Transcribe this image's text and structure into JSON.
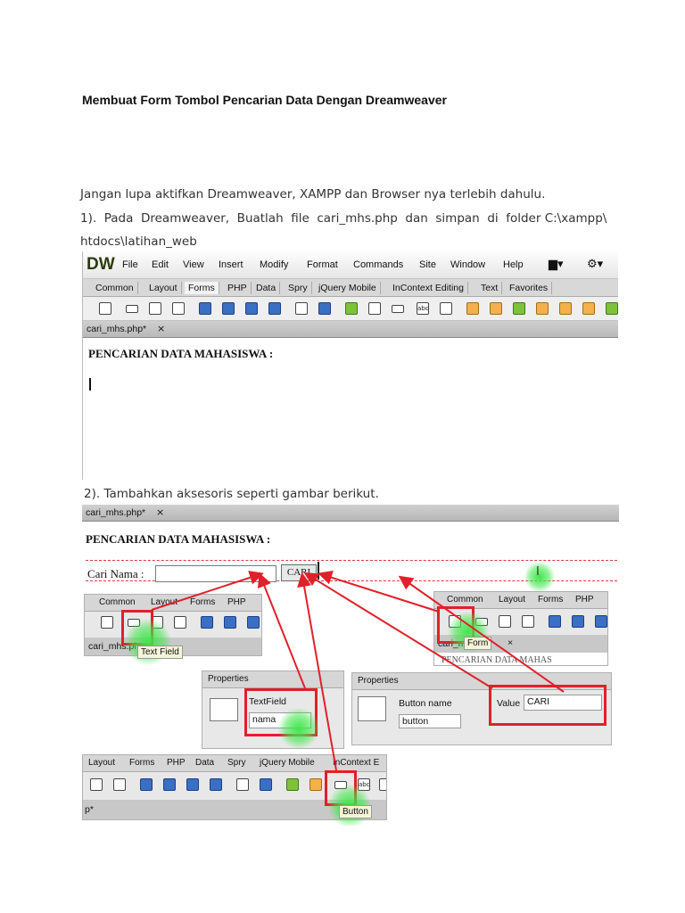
{
  "title": "Membuat Form  Tombol Pencarian Data Dengan Dreamweaver",
  "intro": "Jangan lupa aktifkan Dreamweaver, XAMPP dan Browser nya terlebih dahulu.",
  "step1": {
    "line1": "1).  Pada  Dreamweaver,  Buatlah  file  cari_mhs.php  dan  simpan  di  folder C:\\xampp\\",
    "line2": "htdocs\\latihan_web"
  },
  "step2": "2). Tambahkan aksesoris seperti gambar berikut.",
  "dw": {
    "logo": "DW",
    "menu": [
      "File",
      "Edit",
      "View",
      "Insert",
      "Modify",
      "Format",
      "Commands",
      "Site",
      "Window",
      "Help"
    ],
    "tabs": [
      "Common",
      "Layout",
      "Forms",
      "PHP",
      "Data",
      "Spry",
      "jQuery Mobile",
      "InContext Editing",
      "Text",
      "Favorites"
    ],
    "active_tab": "Forms",
    "doc_tab": "cari_mhs.php*",
    "close": "×",
    "page_heading": "PENCARIAN DATA MAHASISWA :"
  },
  "shot2": {
    "doc_tab": "cari_mhs.php*",
    "close": "×",
    "page_heading": "PENCARIAN DATA MAHASISWA :",
    "form_label": "Cari Nama :",
    "button_text": "CARI",
    "mini_tabs_left": [
      "Common",
      "Layout",
      "Forms",
      "PHP"
    ],
    "mini_doc_left": "cari_mhs.php",
    "tooltip_textfield": "Text Field",
    "mini_tabs_right": [
      "Common",
      "Layout",
      "Forms",
      "PHP"
    ],
    "mini_doc_right": "cari_m",
    "tooltip_form": "Form",
    "right_fragment": "PENCARIAN DATA MAHAS",
    "props1": {
      "tab": "Properties",
      "label": "TextField",
      "value": "nama"
    },
    "props2": {
      "tab": "Properties",
      "button_name_label": "Button name",
      "button_name_value": "button",
      "value_label": "Value",
      "value_value": "CARI"
    },
    "bottom_tabs": [
      "Layout",
      "Forms",
      "PHP",
      "Data",
      "Spry",
      "jQuery Mobile",
      "InContext E"
    ],
    "bottom_doc": "p*",
    "tooltip_button": "Button"
  }
}
